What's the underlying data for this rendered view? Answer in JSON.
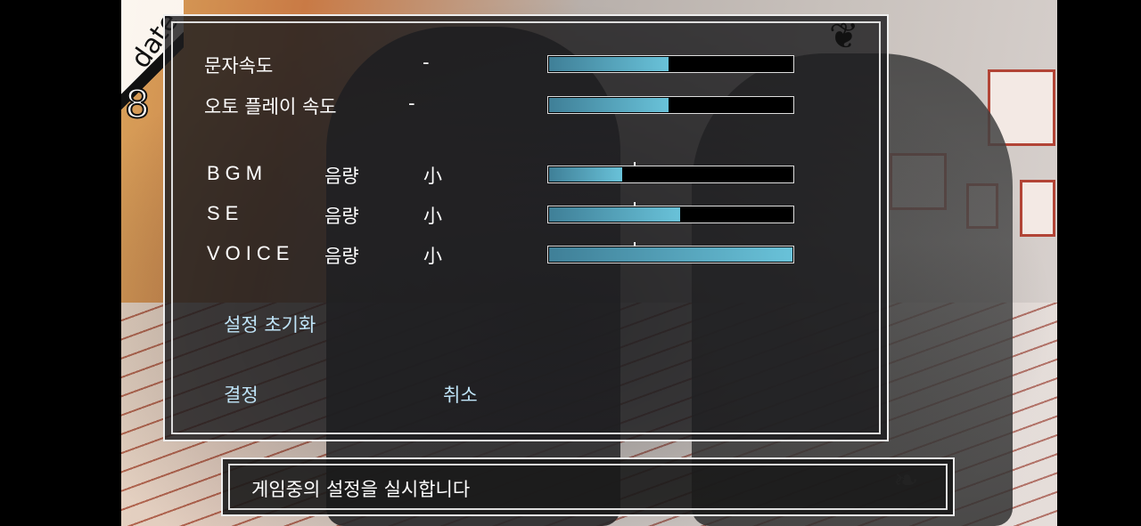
{
  "badge": {
    "word": "date",
    "number": "8"
  },
  "settings": {
    "text_speed": {
      "label": "문자속도",
      "marker": "-",
      "value": 0.49
    },
    "auto_speed": {
      "label": "오토 플레이 속도",
      "marker": "-",
      "value": 0.49
    },
    "bgm": {
      "label": "BGM",
      "sub": "음량",
      "marker": "小",
      "value": 0.3
    },
    "se": {
      "label": "SE",
      "sub": "음량",
      "marker": "小",
      "value": 0.54
    },
    "voice": {
      "label": "VOICE",
      "sub": "음량",
      "marker": "小",
      "value": 1.0
    }
  },
  "buttons": {
    "reset": "설정 초기화",
    "confirm": "결정",
    "cancel": "취소"
  },
  "message": "게임중의 설정을 실시합니다",
  "colors": {
    "slider_fill": "#69c2d9",
    "button_text": "#bfe4f8"
  }
}
